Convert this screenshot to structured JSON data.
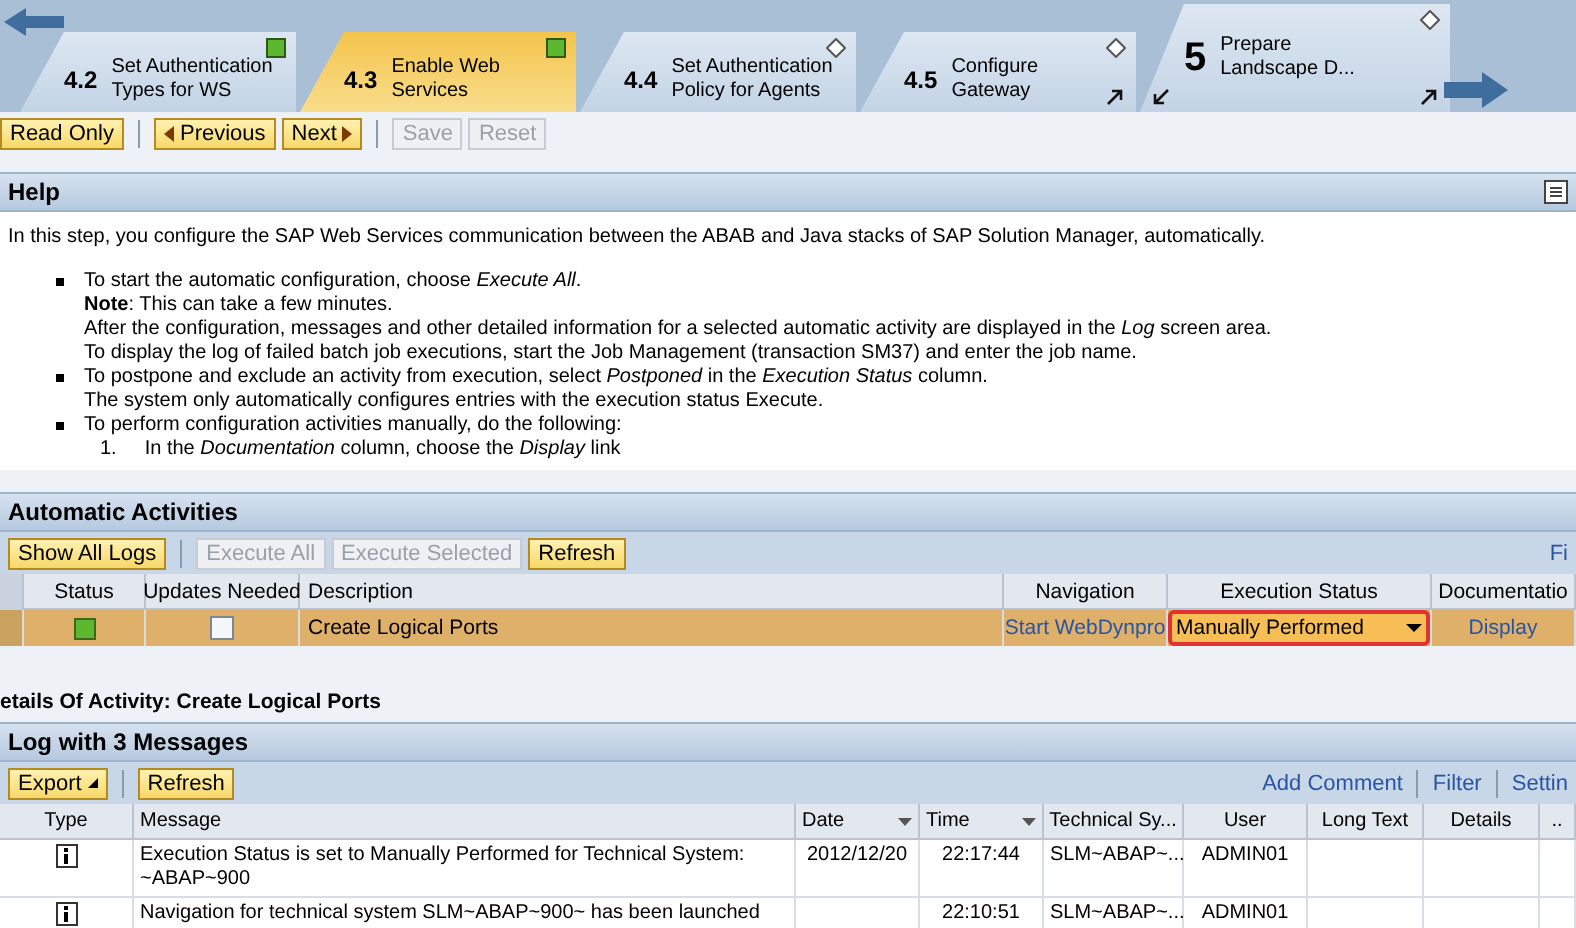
{
  "roadmap": {
    "steps": [
      {
        "number": "4.2",
        "label": "Set Authentication Types for WS",
        "selected": false,
        "completed": true
      },
      {
        "number": "4.3",
        "label": "Enable Web Services",
        "selected": true,
        "completed": true
      },
      {
        "number": "4.4",
        "label": "Set Authentication Policy for Agents",
        "selected": false,
        "completed": false
      },
      {
        "number": "4.5",
        "label": "Configure Gateway",
        "selected": false,
        "completed": false,
        "out_arrow": true
      },
      {
        "number": "5",
        "label": "Prepare Landscape D...",
        "selected": false,
        "completed": false,
        "in_arrow": true,
        "out_arrow": true,
        "kind": "phase"
      }
    ]
  },
  "toolbar": {
    "buttons": [
      {
        "label": "Read Only",
        "kind": "plain",
        "disabled": false
      },
      {
        "label": "Previous",
        "kind": "prev",
        "disabled": false
      },
      {
        "label": "Next",
        "kind": "next",
        "disabled": false
      },
      {
        "label": "Save",
        "kind": "plain",
        "disabled": true
      },
      {
        "label": "Reset",
        "kind": "plain",
        "disabled": true
      }
    ]
  },
  "help": {
    "title": "Help",
    "intro": "In this step, you configure the SAP Web Services communication between the ABAB and Java stacks of SAP Solution Manager, automatically.",
    "bullets": [
      {
        "lines": [
          "To start the automatic configuration, choose *Execute All*.",
          "**Note**: This can take a few minutes.",
          "After the configuration, messages and other detailed information for a selected automatic activity are displayed in the *Log* screen area.",
          "To display the log of failed batch job executions, start the Job Management (transaction SM37) and enter the job name."
        ]
      },
      {
        "lines": [
          "To postpone and exclude an activity from execution, select *Postponed* in the *Execution Status* column.",
          "The system only automatically configures entries with the execution status Execute."
        ]
      },
      {
        "lines": [
          "To perform configuration activities manually, do the following:"
        ],
        "steps": [
          {
            "number": "1.",
            "text": "In the *Documentation* column, choose the *Display* link"
          }
        ]
      }
    ]
  },
  "activities": {
    "title": "Automatic Activities",
    "buttons": [
      {
        "label": "Show All Logs",
        "disabled": false
      },
      {
        "label": "Execute All",
        "disabled": true
      },
      {
        "label": "Execute Selected",
        "disabled": true
      },
      {
        "label": "Refresh",
        "disabled": false
      }
    ],
    "filter_link": "Fi",
    "columns": [
      "Status",
      "Updates Needed",
      "Description",
      "Navigation",
      "Execution Status",
      "Documentatio"
    ],
    "rows": [
      {
        "selected": true,
        "color": "#5cb82e",
        "updates_needed": false,
        "description": "Create Logical Ports",
        "navigation": "Start WebDynpro",
        "execution_status": "Manually Performed",
        "documentation": "Display"
      }
    ],
    "details_title": "etails Of Activity: Create Logical Ports"
  },
  "log": {
    "title": "Log with 3 Messages",
    "buttons": [
      {
        "label": "Export",
        "kind": "menu"
      },
      {
        "label": "Refresh",
        "kind": "plain"
      }
    ],
    "links": [
      "Add Comment",
      "Filter",
      "Settin"
    ],
    "columns": [
      {
        "label": "Type",
        "filter": false
      },
      {
        "label": "Message",
        "filter": false
      },
      {
        "label": "Date",
        "filter": true
      },
      {
        "label": "Time",
        "filter": true
      },
      {
        "label": "Technical Sy...",
        "filter": false
      },
      {
        "label": "User",
        "filter": false
      },
      {
        "label": "Long Text",
        "filter": false
      },
      {
        "label": "Details",
        "filter": false
      },
      {
        "label": "..",
        "filter": false
      }
    ],
    "rows": [
      {
        "kind": "info",
        "message": "Execution Status is set to Manually Performed for Technical System: ~ABAP~900",
        "date": "2012/12/20",
        "time": "22:17:44",
        "technical_system": "SLM~ABAP~...",
        "user": "ADMIN01"
      },
      {
        "kind": "info",
        "message": "Navigation for technical system SLM~ABAP~900~ has been launched",
        "time": "22:10:51",
        "technical_system": "SLM~ABAP~...",
        "user": "ADMIN01"
      }
    ]
  }
}
